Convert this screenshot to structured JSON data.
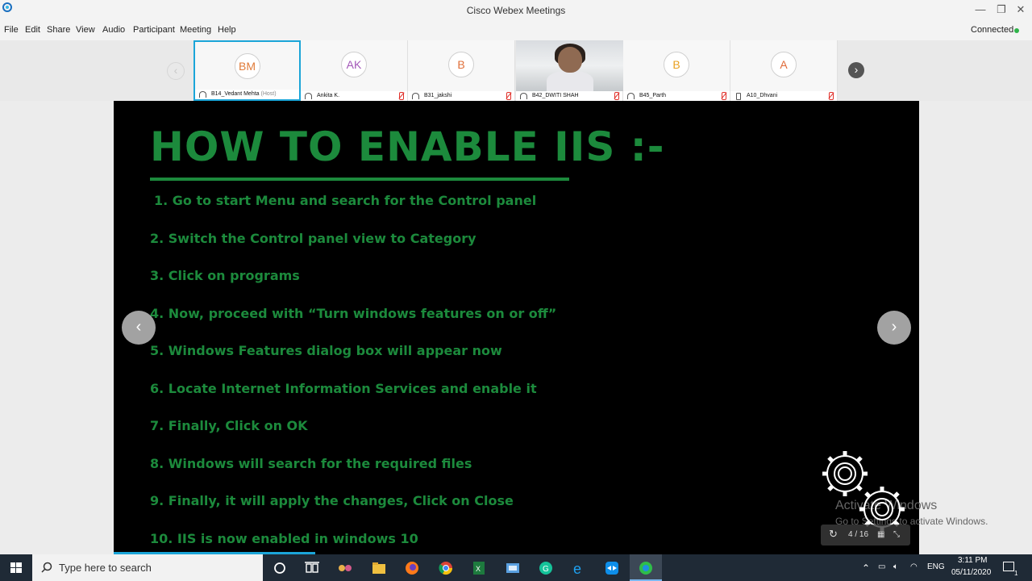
{
  "window": {
    "title": "Cisco Webex Meetings",
    "minimize": "—",
    "restore": "❐",
    "close": "✕"
  },
  "menu": {
    "file": "File",
    "edit": "Edit",
    "share": "Share",
    "view": "View",
    "audio": "Audio",
    "participant": "Participant",
    "meeting": "Meeting",
    "help": "Help"
  },
  "status": {
    "text": "Connected",
    "color": "#2fb34a"
  },
  "strip": {
    "prev": "‹",
    "next": "›"
  },
  "participants": [
    {
      "initials": "BM",
      "initials_color": "#e07b39",
      "name": "B14_Vedant Mehta",
      "role": "(Host)",
      "active": true
    },
    {
      "initials": "AK",
      "initials_color": "#a357b8",
      "name": "Ankita K."
    },
    {
      "initials": "B",
      "initials_color": "#e0703a",
      "name": "B31_jakshi"
    },
    {
      "initials": "",
      "name": "B42_DWITI SHAH",
      "video": true
    },
    {
      "initials": "B",
      "initials_color": "#e8a020",
      "name": "B45_Parth"
    },
    {
      "initials": "A",
      "initials_color": "#e06b3a",
      "name": "A10_Dhvani"
    }
  ],
  "slide": {
    "title": "HOW TO ENABLE IIS :-",
    "steps": [
      "1. Go to start Menu and search for the Control panel",
      "2. Switch the Control panel view to Category",
      "3. Click on programs",
      "4. Now, proceed with “Turn windows features on or off”",
      "5. Windows Features dialog box will appear now",
      "6. Locate Internet Information Services and enable it",
      "7. Finally, Click on OK",
      "8. Windows will search for the required files",
      "9. Finally, it will apply the changes, Click on Close",
      "10. IIS is now enabled in windows 10"
    ],
    "page_indicator": "4 / 16",
    "prev": "‹",
    "next": "›",
    "accent_color": "#1c8a3c"
  },
  "watermark": {
    "line1": "Activate Windows",
    "line2": "Go to Settings to activate Windows."
  },
  "taskbar": {
    "search_placeholder": "Type here to search",
    "language": "ENG",
    "time": "3:11 PM",
    "date": "05/11/2020",
    "notification_count": "1"
  }
}
